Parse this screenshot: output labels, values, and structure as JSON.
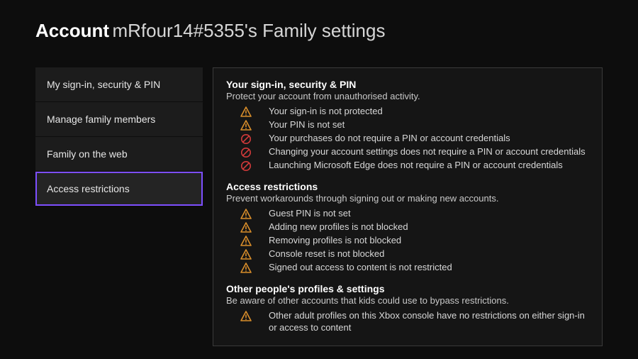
{
  "header": {
    "prefix": "Account",
    "rest": "mRfour14#5355's Family settings"
  },
  "sidebar": {
    "items": [
      {
        "label": "My sign-in, security & PIN",
        "selected": false
      },
      {
        "label": "Manage family members",
        "selected": false
      },
      {
        "label": "Family on the web",
        "selected": false
      },
      {
        "label": "Access restrictions",
        "selected": true
      }
    ]
  },
  "sections": [
    {
      "title": "Your sign-in, security & PIN",
      "subtitle": "Protect your account from unauthorised activity.",
      "items": [
        {
          "icon": "warning",
          "text": "Your sign-in is not protected"
        },
        {
          "icon": "warning",
          "text": "Your PIN is not set"
        },
        {
          "icon": "block",
          "text": "Your purchases do not require a PIN or account credentials"
        },
        {
          "icon": "block",
          "text": "Changing your account settings does not require a PIN or account credentials"
        },
        {
          "icon": "block",
          "text": "Launching Microsoft Edge does not require a PIN or account credentials"
        }
      ]
    },
    {
      "title": "Access restrictions",
      "subtitle": "Prevent workarounds through signing out or making new accounts.",
      "items": [
        {
          "icon": "warning",
          "text": "Guest PIN is not set"
        },
        {
          "icon": "warning",
          "text": "Adding new profiles is not blocked"
        },
        {
          "icon": "warning",
          "text": "Removing profiles is not blocked"
        },
        {
          "icon": "warning",
          "text": "Console reset is not blocked"
        },
        {
          "icon": "warning",
          "text": "Signed out access to content is not restricted"
        }
      ]
    },
    {
      "title": "Other people's profiles & settings",
      "subtitle": "Be aware of other accounts that kids could use to bypass restrictions.",
      "items": [
        {
          "icon": "warning",
          "text": "Other adult profiles on this Xbox console have no restrictions on either sign-in or access to content"
        }
      ]
    }
  ],
  "colors": {
    "warning": "#d98e2b",
    "block": "#d23a3a",
    "focus": "#7d4fff"
  }
}
